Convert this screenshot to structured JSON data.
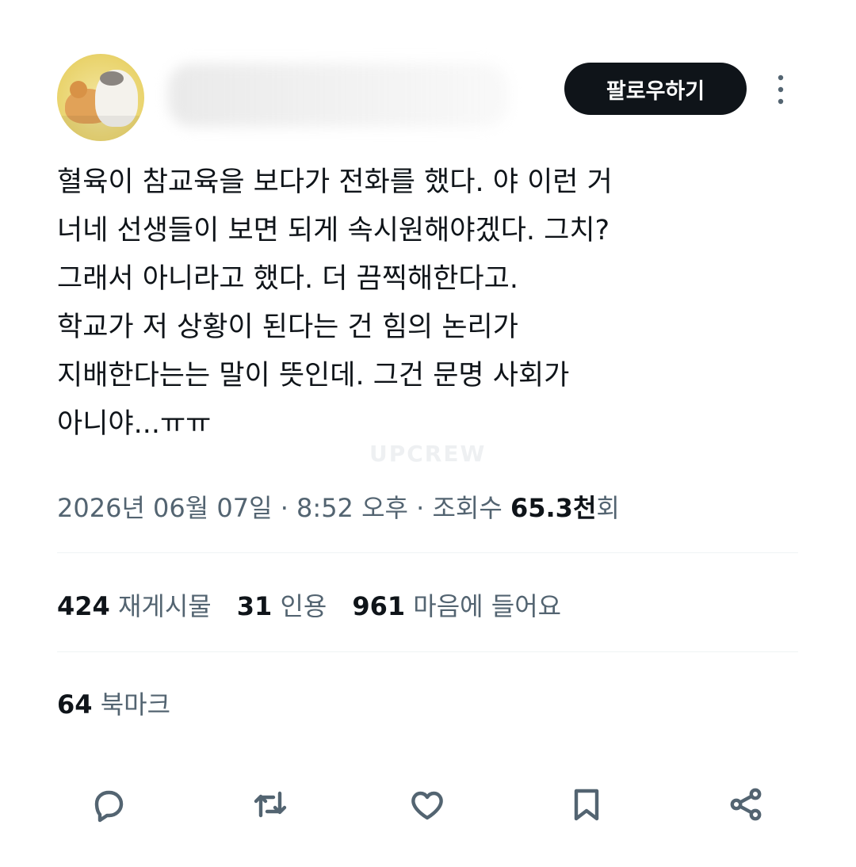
{
  "header": {
    "follow_label": "팔로우하기"
  },
  "tweet": {
    "lines": [
      "혈육이 참교육을 보다가 전화를 했다. 야 이런 거",
      "너네 선생들이 보면 되게 속시원해야겠다. 그치?",
      "그래서 아니라고 했다. 더 끔찍해한다고.",
      "학교가 저 상황이 된다는 건 힘의 논리가",
      "지배한다는는 말이 뜻인데. 그건 문명 사회가",
      "아니야...ㅠㅠ"
    ],
    "watermark": "UPCREW"
  },
  "meta": {
    "datetime": "2026년 06월 07일 · 8:52 오후 · 조회수 ",
    "views": "65.3천",
    "views_suffix": "회"
  },
  "stats": {
    "reposts_count": "424",
    "reposts_label": "재게시물",
    "quotes_count": "31",
    "quotes_label": "인용",
    "likes_count": "961",
    "likes_label": "마음에 들어요",
    "bookmarks_count": "64",
    "bookmarks_label": "북마크"
  },
  "actions": {
    "icons": [
      "reply-icon",
      "repost-icon",
      "like-icon",
      "bookmark-icon",
      "share-icon"
    ]
  },
  "colors": {
    "text": "#0f1419",
    "secondary": "#536471",
    "divider": "#eff3f4",
    "button_bg": "#0f1419",
    "button_text": "#ffffff"
  }
}
